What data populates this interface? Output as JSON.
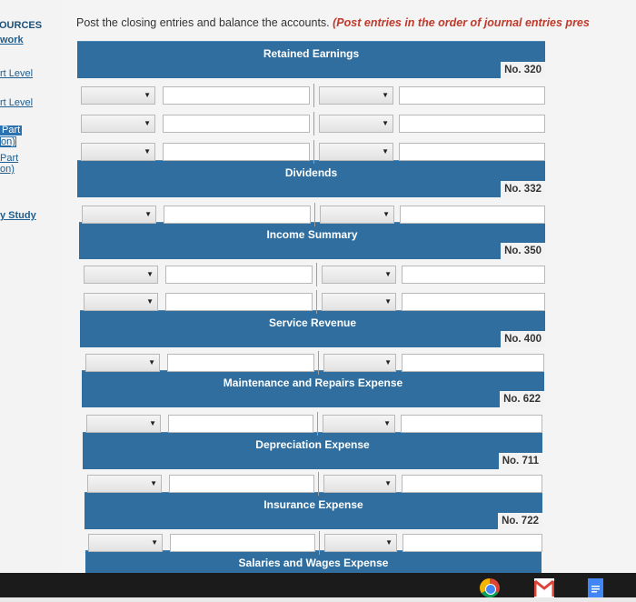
{
  "sidebar": {
    "resources": "OURCES",
    "work": "work",
    "level1": "rt Level",
    "level2": "rt Level",
    "part1a": "Part",
    "part1b": "on)",
    "part2a": "Part",
    "part2b": "on)",
    "study": "y Study"
  },
  "instructions": {
    "text": "Post the closing entries and balance the accounts.",
    "emphasis": "(Post entries in the order of journal entries pres"
  },
  "accounts": [
    {
      "title": "Retained Earnings",
      "number": "No. 320"
    },
    {
      "title": "Dividends",
      "number": "No. 332"
    },
    {
      "title": "Income Summary",
      "number": "No. 350"
    },
    {
      "title": "Service Revenue",
      "number": "No. 400"
    },
    {
      "title": "Maintenance and Repairs Expense",
      "number": "No. 622"
    },
    {
      "title": "Depreciation Expense",
      "number": "No. 711"
    },
    {
      "title": "Insurance Expense",
      "number": "No. 722"
    },
    {
      "title": "Salaries and Wages Expense",
      "number": ""
    }
  ],
  "dropdown_arrow": "▼",
  "colors": {
    "header": "#2f6e9f",
    "emphasis": "#c0392b",
    "sidebar_link": "#1f5e8e"
  },
  "taskbar": {
    "icons": [
      "chrome-icon",
      "gmail-icon",
      "docs-icon"
    ]
  }
}
